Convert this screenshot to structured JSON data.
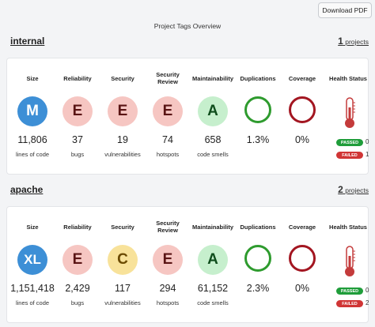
{
  "toolbar": {
    "download_label": "Download PDF"
  },
  "overview_title": "Project Tags Overview",
  "headers": {
    "size": "Size",
    "reliability": "Reliability",
    "security": "Security",
    "security_review": "Security Review",
    "maintainability": "Maintainability",
    "duplications": "Duplications",
    "coverage": "Coverage",
    "health": "Health Status"
  },
  "status_labels": {
    "passed": "PASSED",
    "failed": "FAILED"
  },
  "tags": [
    {
      "name": "internal",
      "projects_count": "1",
      "projects_label": "projects",
      "size": {
        "grade": "M",
        "value": "11,806",
        "unit": "lines of code"
      },
      "reliability": {
        "grade": "E",
        "value": "37",
        "unit": "bugs"
      },
      "security": {
        "grade": "E",
        "value": "19",
        "unit": "vulnerabilities"
      },
      "security_review": {
        "grade": "E",
        "value": "74",
        "unit": "hotspots"
      },
      "maintainability": {
        "grade": "A",
        "value": "658",
        "unit": "code smells"
      },
      "duplications": {
        "value": "1.3%",
        "ring_color": "#2e9b2e"
      },
      "coverage": {
        "value": "0%",
        "ring_color": "#a31621"
      },
      "health": {
        "passed": "0",
        "failed": "1"
      }
    },
    {
      "name": "apache",
      "projects_count": "2",
      "projects_label": "projects",
      "size": {
        "grade": "XL",
        "value": "1,151,418",
        "unit": "lines of code"
      },
      "reliability": {
        "grade": "E",
        "value": "2,429",
        "unit": "bugs"
      },
      "security": {
        "grade": "C",
        "value": "117",
        "unit": "vulnerabilities"
      },
      "security_review": {
        "grade": "E",
        "value": "294",
        "unit": "hotspots"
      },
      "maintainability": {
        "grade": "A",
        "value": "61,152",
        "unit": "code smells"
      },
      "duplications": {
        "value": "2.3%",
        "ring_color": "#2e9b2e"
      },
      "coverage": {
        "value": "0%",
        "ring_color": "#a31621"
      },
      "health": {
        "passed": "0",
        "failed": "2"
      }
    }
  ],
  "colors": {
    "size_badge_bg": "#3d8fd6",
    "size_badge_text": "#ffffff",
    "grade_e_bg": "#f6c6c2",
    "grade_e_text": "#5a1414",
    "grade_c_bg": "#f8e29a",
    "grade_c_text": "#6b4a00",
    "grade_a_bg": "#c6efcd",
    "grade_a_text": "#0f4d1c",
    "thermometer": "#c43b3b"
  },
  "icons": {
    "health_status": "thermometer-icon"
  }
}
